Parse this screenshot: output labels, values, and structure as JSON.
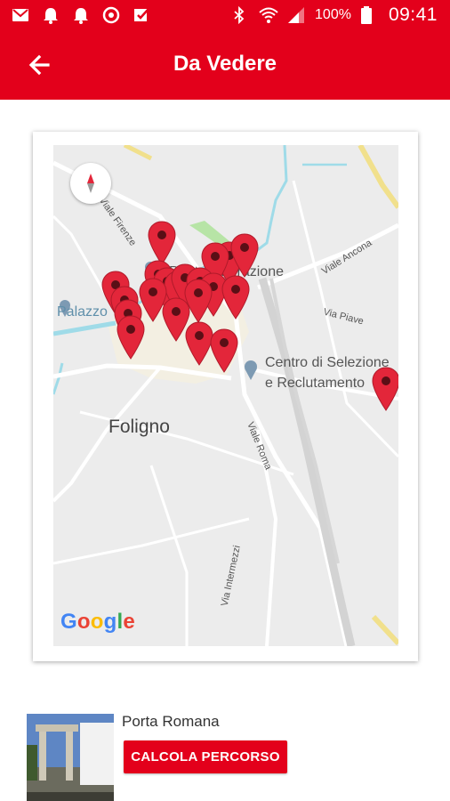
{
  "status_bar": {
    "battery": "100%",
    "time": "09:41",
    "left_icons": [
      "mail-icon",
      "bell-icon",
      "bell-icon",
      "sync-icon",
      "checklist-icon"
    ],
    "right_icons": [
      "bluetooth-icon",
      "wifi-icon",
      "signal-icon",
      "battery-icon"
    ]
  },
  "app_bar": {
    "title": "Da Vedere",
    "back_icon": "arrow-left-icon"
  },
  "map": {
    "labels": {
      "palazzo": "Palazzo",
      "ponte_liberazione": "Ponte Liberazione",
      "viale_ancona": "Viale Ancona",
      "viale_firenze": "Viale Firenze",
      "via_piave": "Via Piave",
      "centro_1": "Centro di Selezione",
      "centro_2": "e Reclutamento",
      "foligno": "Foligno",
      "viale_roma": "Viale Roma",
      "via_intermezzi": "Via Intermezzi"
    },
    "attribution": "Google",
    "marker_color": "#e3263a"
  },
  "list_item": {
    "title": "Porta Romana",
    "button_label": "CALCOLA PERCORSO"
  },
  "colors": {
    "primary": "#e3001b",
    "map_bg": "#ececec",
    "water": "#9fdbe8",
    "park": "#b7e4a6"
  }
}
